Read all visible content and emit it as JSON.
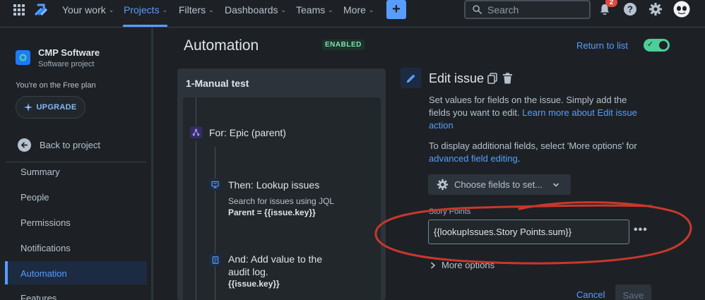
{
  "topnav": {
    "items": [
      {
        "label": "Your work"
      },
      {
        "label": "Projects"
      },
      {
        "label": "Filters"
      },
      {
        "label": "Dashboards"
      },
      {
        "label": "Teams"
      },
      {
        "label": "More"
      }
    ],
    "create_label": "+",
    "search_placeholder": "Search",
    "notification_count": "2"
  },
  "sidebar": {
    "project_name": "CMP Software",
    "project_type": "Software project",
    "plan_text": "You're on the Free plan",
    "upgrade_label": "UPGRADE",
    "back_label": "Back to project",
    "items": [
      {
        "label": "Summary"
      },
      {
        "label": "People"
      },
      {
        "label": "Permissions"
      },
      {
        "label": "Notifications"
      },
      {
        "label": "Automation"
      },
      {
        "label": "Features"
      }
    ]
  },
  "header": {
    "title": "Automation",
    "status": "ENABLED",
    "return_label": "Return to list",
    "toggle_on": true
  },
  "rule": {
    "name": "1-Manual test",
    "components": [
      {
        "title": "For: Epic (parent)"
      },
      {
        "title": "Then: Lookup issues",
        "description": "Search for issues using JQL",
        "detail": "Parent = {{issue.key}}"
      },
      {
        "title_line1": "And: Add value to the",
        "title_line2": "audit log.",
        "detail": "{{issue.key}}"
      }
    ]
  },
  "edit": {
    "title": "Edit issue",
    "desc_text": "Set values for fields on the issue. Simply add the fields you want to edit. ",
    "desc_link": "Learn more about Edit issue action",
    "advanced_text": "To display additional fields, select 'More options' for ",
    "advanced_link": "advanced field editing",
    "advanced_end": ".",
    "choose_label": "Choose fields to set...",
    "field_label": "Story Points",
    "field_value": "{{lookupIssues.Story Points.sum}}",
    "more_options_label": "More options",
    "cancel_label": "Cancel",
    "save_label": "Save"
  },
  "colors": {
    "accent": "#579dff",
    "annotation": "#c9372c",
    "enabled": "#4bce97"
  }
}
